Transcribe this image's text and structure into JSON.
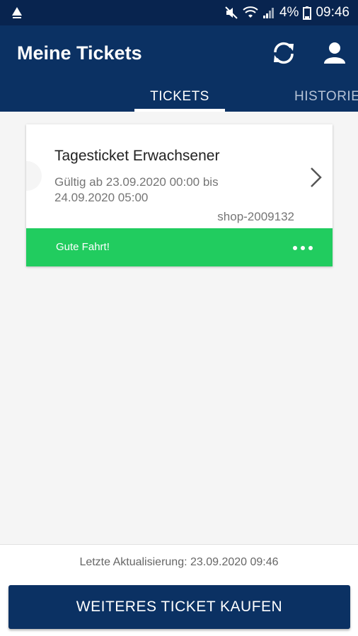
{
  "status_bar": {
    "battery": "4%",
    "time": "09:46",
    "left_icon": "mvv-logo-icon"
  },
  "app_bar": {
    "title": "Meine Tickets",
    "icons": [
      "refresh-icon",
      "profile-icon"
    ]
  },
  "tabs": [
    {
      "label": "TICKETS",
      "selected": true
    },
    {
      "label": "HISTORIE",
      "selected": false
    }
  ],
  "ticket": {
    "title": "Tagesticket Erwachsener",
    "validity": "Gültig ab 23.09.2020 00:00 bis 24.09.2020 05:00",
    "id": "shop-2009132",
    "status": "Gute Fahrt!",
    "status_color": "#21cc5f"
  },
  "footer": {
    "last_update": "Letzte Aktualisierung: 23.09.2020 09:46",
    "buy_button": "WEITERES TICKET KAUFEN"
  },
  "colors": {
    "primary": "#0b3163",
    "status_bar": "#08244f"
  }
}
